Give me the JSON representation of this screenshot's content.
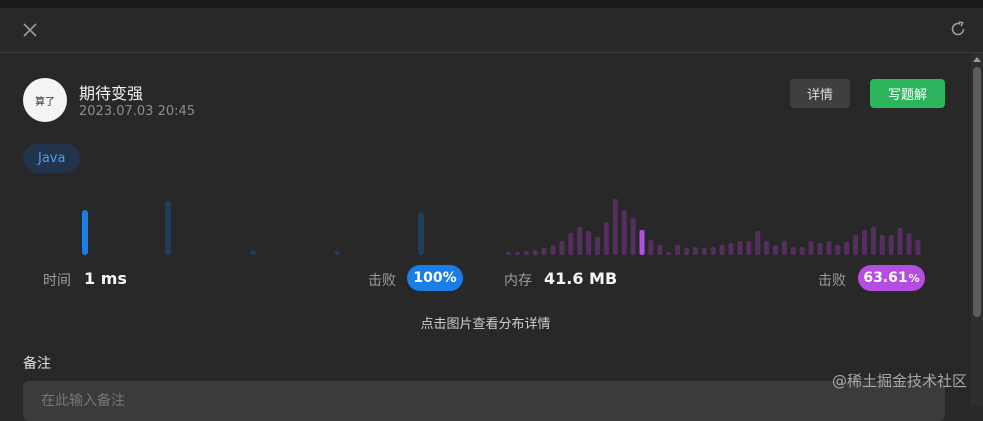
{
  "header": {
    "close_icon": "close-icon",
    "refresh_icon": "refresh-icon"
  },
  "submission": {
    "avatar_text": "算了",
    "username": "期待变强",
    "timestamp": "2023.07.03 20:45",
    "detail_button": "详情",
    "solution_button": "写题解",
    "language": "Java"
  },
  "runtime": {
    "label": "时间",
    "value": "1 ms",
    "beat_label": "击败",
    "beat_value": "100%"
  },
  "memory": {
    "label": "内存",
    "value": "41.6 MB",
    "beat_label": "击败",
    "beat_value": "63.61",
    "beat_unit": "%"
  },
  "hint_text": "点击图片查看分布详情",
  "notes": {
    "title": "备注",
    "placeholder": "在此输入备注"
  },
  "watermark": "@稀土掘金技术社区",
  "colors": {
    "accent_blue": "#1a7ee6",
    "accent_purple": "#b44ee0",
    "green": "#2db55d",
    "background": "#282828"
  },
  "chart_data": [
    {
      "type": "bar",
      "title": "",
      "x": [
        1,
        2,
        3,
        4,
        5
      ],
      "values": [
        42,
        50,
        4,
        4,
        40
      ],
      "highlight_index": 0,
      "colors": {
        "highlight": "#1a7ee6",
        "normal": "#233c58"
      }
    },
    {
      "type": "bar",
      "title": "",
      "values": [
        3,
        3,
        4,
        5,
        7,
        10,
        14,
        22,
        28,
        24,
        18,
        33,
        56,
        45,
        37,
        25,
        15,
        10,
        3,
        10,
        7,
        8,
        7,
        8,
        10,
        12,
        14,
        14,
        24,
        14,
        10,
        14,
        8,
        8,
        14,
        12,
        14,
        10,
        13,
        20,
        25,
        28,
        20,
        20,
        27,
        22,
        15
      ],
      "highlight_index": 15,
      "colors": {
        "highlight": "#b44ee0",
        "normal": "#55305f"
      }
    }
  ]
}
